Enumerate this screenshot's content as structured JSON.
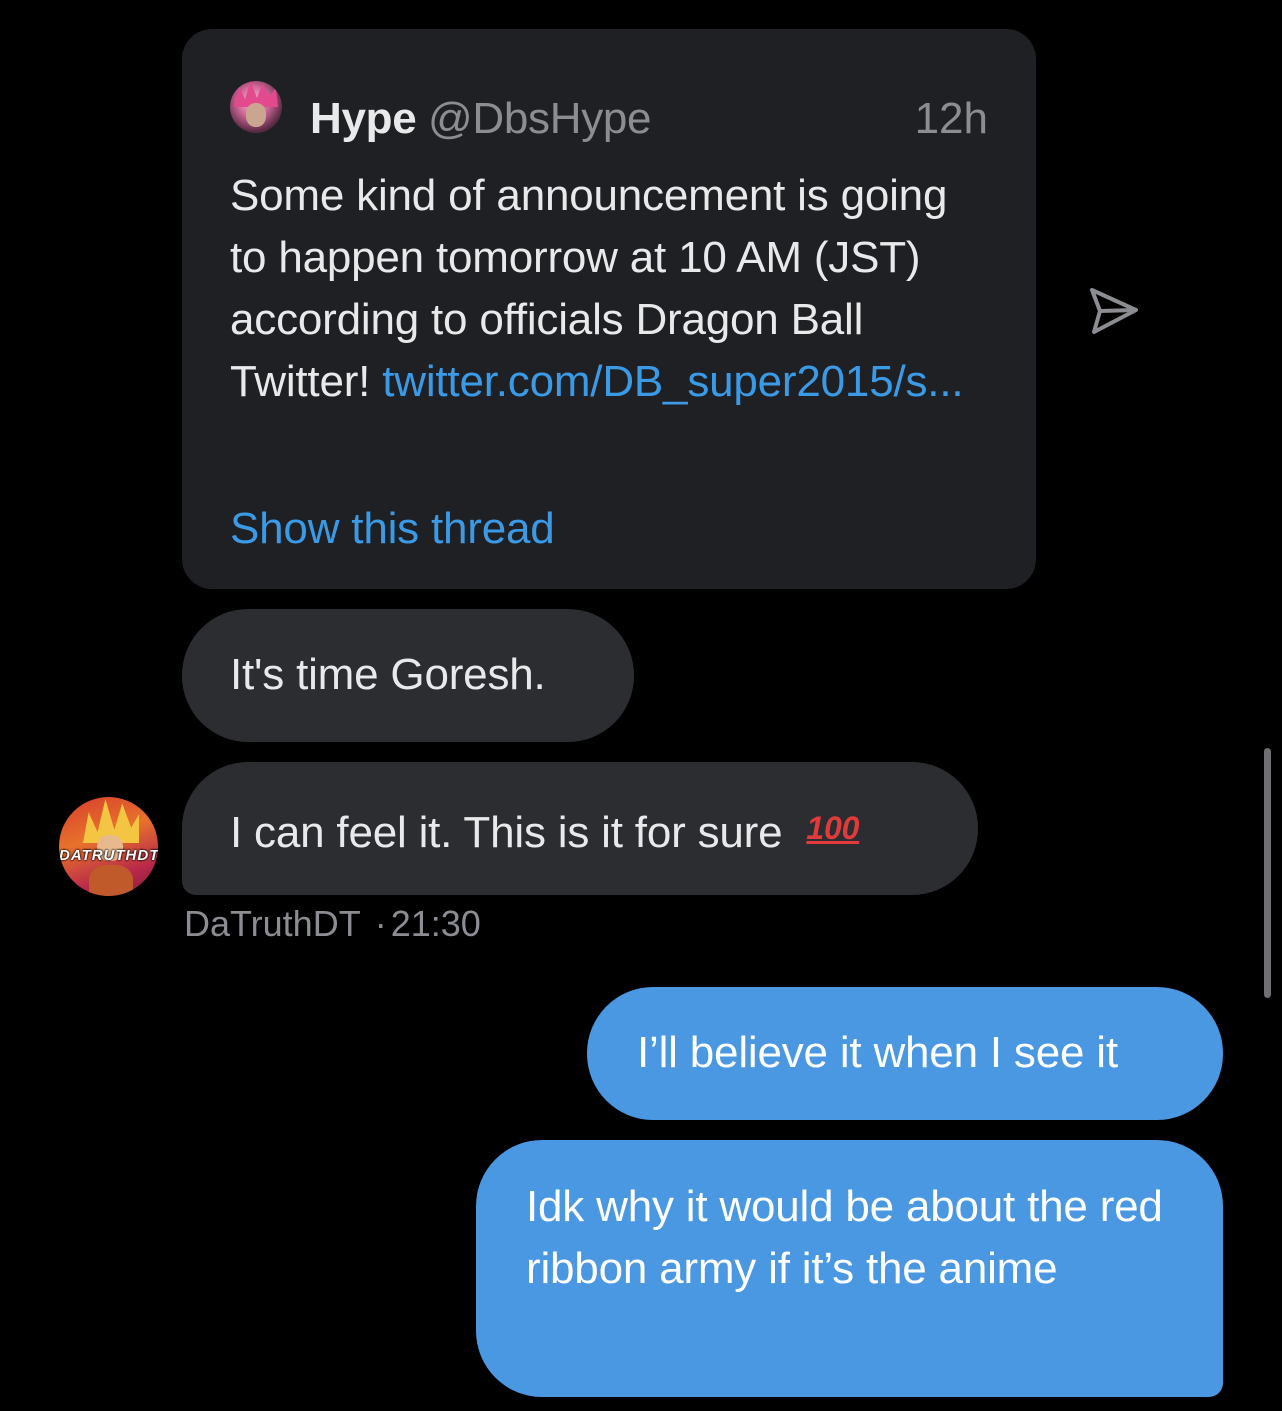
{
  "quoted_tweet": {
    "name": "Hype",
    "handle": "@DbsHype",
    "time": "12h",
    "text": "Some kind of announcement is going to happen tomorrow at 10 AM (JST) according to officials Dragon Ball Twitter! ",
    "link": "twitter.com/DB_super2015/s...",
    "show_thread": "Show this thread"
  },
  "messages": [
    {
      "direction": "incoming",
      "text": "It's time Goresh."
    },
    {
      "direction": "incoming",
      "text": "I can feel it. This is it for sure ",
      "emoji": "100"
    },
    {
      "direction": "outgoing",
      "text": "I’ll believe it when I see it"
    },
    {
      "direction": "outgoing",
      "text": "Idk why it would be about the red ribbon army if it’s the anime"
    }
  ],
  "sender": {
    "name": "DaTruthDT",
    "separator": "·",
    "time": "21:30",
    "avatar_text": "DATRUTHDT"
  },
  "icons": {
    "share": "send-arrow-icon"
  },
  "colors": {
    "background": "#000000",
    "incoming_bubble": "#2b2d31",
    "quoted_card": "#1f2023",
    "outgoing_bubble": "#4a97e2",
    "link": "#3b9ae6",
    "muted_text": "#8b8d92"
  }
}
